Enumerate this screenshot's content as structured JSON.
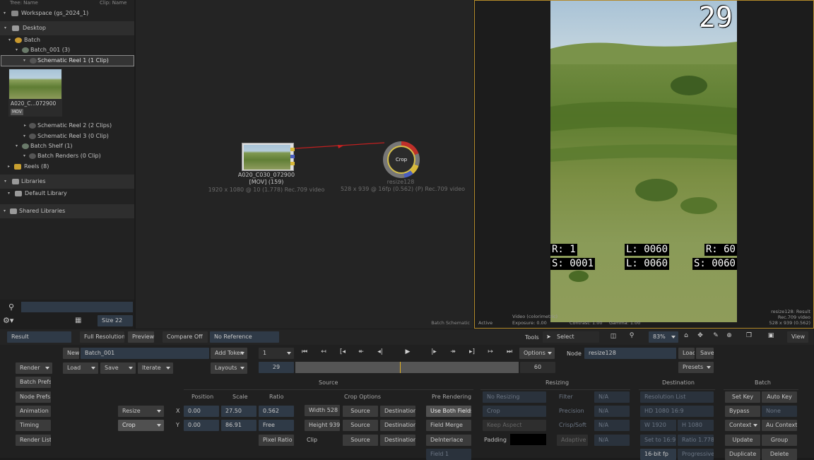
{
  "media_panel": {
    "header_left": "Tree: Name",
    "header_right": "Clip: Name",
    "workspace": "Workspace (gs_2024_1)",
    "desktop": "Desktop",
    "batch": "Batch",
    "batch_001": "Batch_001 (3)",
    "schematic_reel_1": "Schematic Reel 1 (1 Clip)",
    "thumb_label": "A020_C...072900",
    "thumb_badge": "MOV",
    "schematic_reel_2": "Schematic Reel 2 (2 Clips)",
    "schematic_reel_3": "Schematic Reel 3 (0 Clip)",
    "batch_shelf": "Batch Shelf (1)",
    "batch_renders": "Batch Renders (0 Clip)",
    "reels": "Reels (8)",
    "libraries": "Libraries",
    "default_library": "Default Library",
    "shared_libraries": "Shared Libraries",
    "search_placeholder": "",
    "size_label": "Size 22"
  },
  "schematic": {
    "clip_node_name": "A020_C030_072900",
    "clip_node_info": "[MOV] (159)",
    "clip_node_res": "1920 x 1080 @ 10 (1.778)  Rec.709 video",
    "crop_node_label": "Crop",
    "crop_node_name": "resize128",
    "crop_node_res": "528 x 939 @ 16fp (0.562) (P) Rec.709 video",
    "footer_label": "Batch Schematic"
  },
  "viewer": {
    "frame_number": "29",
    "r_value": "R: 1",
    "s_value": "S: 0001",
    "l_value_top": "L: 0060",
    "l_value_bottom": "L: 0060",
    "r_value_right": "R: 60",
    "s_value_right": "S: 0060",
    "status_active": "Active",
    "status_video": "Video (colorimetric)",
    "status_exposure": "Exposure: 0.00",
    "status_contrast": "Contrast: 1.00",
    "status_gamma": "Gamma: 1.00",
    "info_result": "resize128: Result",
    "info_colour": "Rec.709 video",
    "info_res": "528 x 939 (0.562)"
  },
  "toolbar": {
    "result": "Result",
    "full_resolution": "Full Resolution",
    "preview": "Preview",
    "compare_off": "Compare Off",
    "no_reference": "No Reference",
    "tools": "Tools",
    "select": "Select",
    "zoom": "83%",
    "view": "View"
  },
  "batch_controls": {
    "new": "New",
    "batch_name": "Batch_001",
    "add_token": "Add Token",
    "layouts": "Layouts",
    "render": "Render",
    "load": "Load",
    "save": "Save",
    "iterate": "Iterate",
    "batch_prefs": "Batch Prefs",
    "node_prefs": "Node Prefs",
    "animation": "Animation",
    "timing": "Timing",
    "render_list": "Render List"
  },
  "transport": {
    "frame_field": "1",
    "current_frame": "29",
    "end_frame": "60",
    "options": "Options",
    "node_label": "Node",
    "node_name": "resize128",
    "load": "Load",
    "save": "Save",
    "presets": "Presets"
  },
  "resize_editor": {
    "resize_tab": "Resize",
    "crop_tab": "Crop",
    "source_header": "Source",
    "position_header": "Position",
    "scale_header": "Scale",
    "ratio_header": "Ratio",
    "x_label": "X",
    "y_label": "Y",
    "pos_x": "0.00",
    "pos_y": "0.00",
    "scale_x": "27.50",
    "scale_y": "86.91",
    "ratio_value": "0.562",
    "ratio_mode": "Free",
    "pixel_ratio": "Pixel Ratio",
    "crop_options_header": "Crop Options",
    "width": "Width 528",
    "height": "Height 939",
    "clip_label": "Clip",
    "source_btn": "Source",
    "destination_btn": "Destination",
    "pre_rendering_header": "Pre Rendering",
    "use_both_fields": "Use Both Fields",
    "field_merge": "Field Merge",
    "deinterlace": "DeInterlace",
    "field_1": "Field 1",
    "resizing_header": "Resizing",
    "no_resizing": "No Resizing",
    "crop_mode": "Crop",
    "keep_aspect": "Keep Aspect",
    "padding_label": "Padding",
    "filter_label": "Filter",
    "precision_label": "Precision",
    "crisp_soft_label": "Crisp/Soft",
    "adaptive_label": "Adaptive",
    "na": "N/A",
    "destination_header": "Destination",
    "resolution_list": "Resolution List",
    "hd_preset": "HD 1080 16:9",
    "dest_w": "W 1920",
    "dest_h": "H 1080",
    "set_to": "Set to 16:9",
    "dest_ratio": "Ratio 1.778",
    "bit_depth": "16-bit fp",
    "scan_mode": "Progressive",
    "batch_header": "Batch",
    "set_key": "Set Key",
    "auto_key": "Auto Key",
    "bypass": "Bypass",
    "none": "None",
    "context": "Context",
    "au_context": "Au Context",
    "update": "Update",
    "group": "Group",
    "duplicate": "Duplicate",
    "delete": "Delete"
  }
}
